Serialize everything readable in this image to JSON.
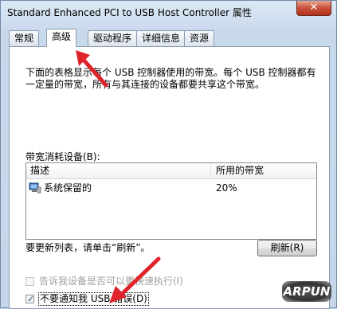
{
  "window": {
    "title": "Standard Enhanced PCI to USB Host Controller 属性",
    "close_label": "✕"
  },
  "tabs": [
    {
      "label": "常规"
    },
    {
      "label": "高级"
    },
    {
      "label": "驱动程序"
    },
    {
      "label": "详细信息"
    },
    {
      "label": "资源"
    }
  ],
  "advanced": {
    "description": "下面的表格显示每个 USB 控制器使用的带宽。每个 USB 控制器都有一定量的带宽，所有与其连接的设备都要共享这个带宽。",
    "devices_label": "带宽消耗设备(B):",
    "columns": [
      "描述",
      "所用的带宽"
    ],
    "rows": [
      {
        "name": "系统保留的",
        "bandwidth": "20%",
        "icon": "usb-controller-icon"
      }
    ],
    "refresh_hint": "要更新列表，请单击“刷新”。",
    "refresh_button": "刷新(R)",
    "checkbox_fast": {
      "label": "告诉我设备是否可以更快速执行(I)",
      "checked": false,
      "disabled": true
    },
    "checkbox_notify": {
      "label": "不要通知我 USB 错误(D)",
      "checked": true,
      "disabled": false
    }
  },
  "watermark": "ARPUN",
  "colors": {
    "arrow": "#e0232b",
    "accent": "#2a4d7c"
  }
}
